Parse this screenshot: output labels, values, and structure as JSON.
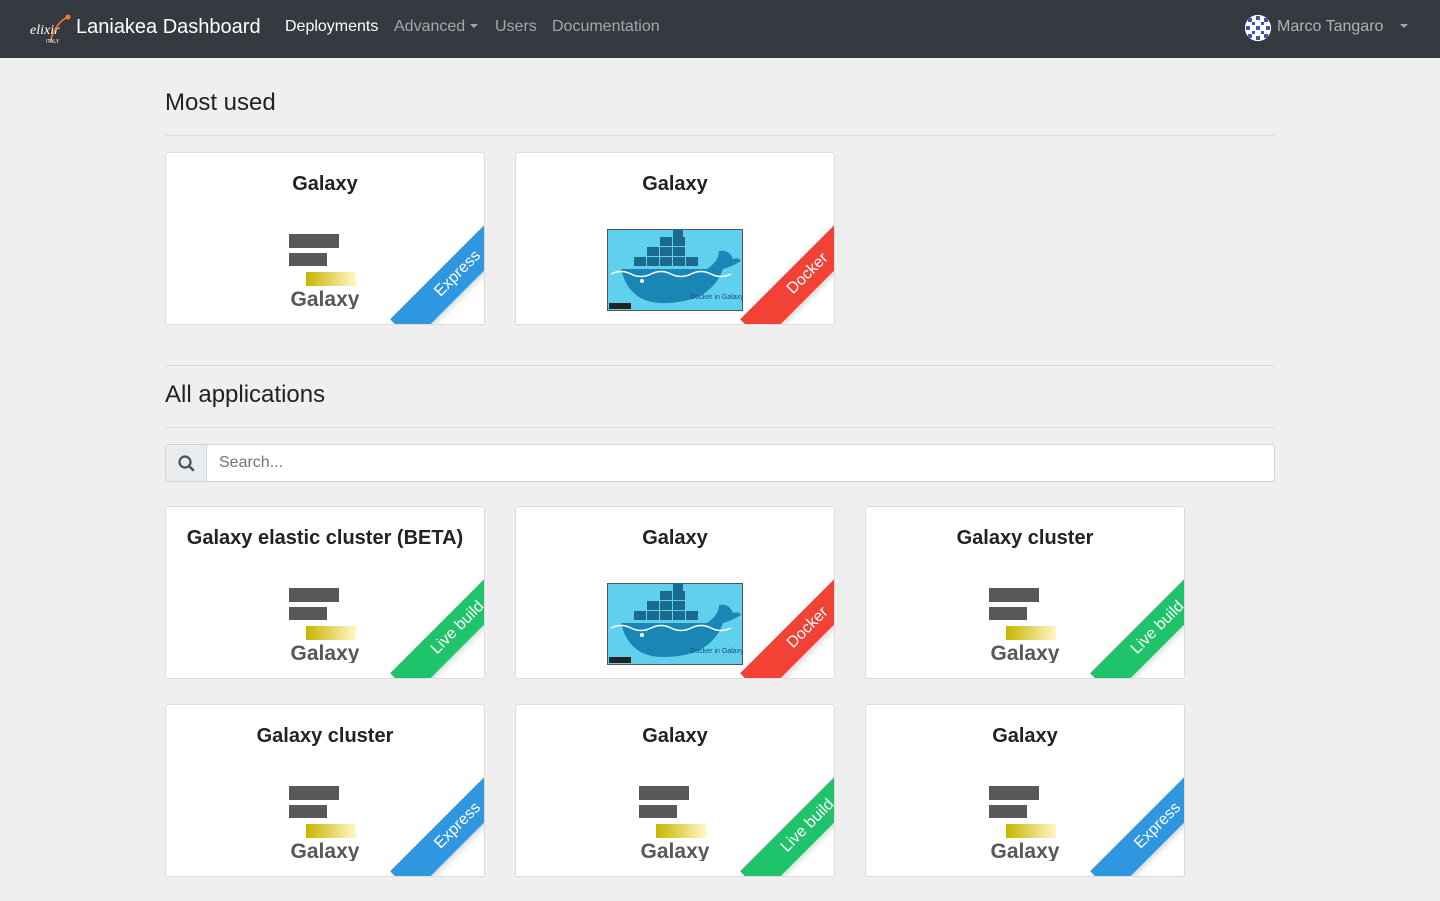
{
  "navbar": {
    "brand_title": "Laniakea Dashboard",
    "logo_text": "elixir",
    "logo_subtext": "ITALY",
    "links": [
      "Deployments",
      "Advanced",
      "Users",
      "Documentation"
    ],
    "user_name": "Marco Tangaro",
    "bg_color": "#343a40"
  },
  "most_used": {
    "title": "Most used",
    "cards": [
      {
        "title": "Galaxy",
        "badge": "Express",
        "logo": "galaxy-logo"
      },
      {
        "title": "Galaxy",
        "badge": "Docker",
        "logo": "docker-galaxy-logo"
      }
    ]
  },
  "all_apps": {
    "title": "All applications",
    "search_placeholder": "Search...",
    "cards": [
      {
        "title": "Galaxy elastic cluster (BETA)",
        "badge": "Live build",
        "logo": "galaxy-logo"
      },
      {
        "title": "Galaxy",
        "badge": "Docker",
        "logo": "docker-galaxy-logo"
      },
      {
        "title": "Galaxy cluster",
        "badge": "Live build",
        "logo": "galaxy-logo"
      },
      {
        "title": "Galaxy cluster",
        "badge": "Express",
        "logo": "galaxy-logo"
      },
      {
        "title": "Galaxy",
        "badge": "Live build",
        "logo": "galaxy-logo"
      },
      {
        "title": "Galaxy",
        "badge": "Express",
        "logo": "galaxy-logo"
      }
    ]
  },
  "galaxy_logo_text": "Galaxy",
  "docker_logo_text": "Docker in Galaxy",
  "badge_colors": {
    "Express": "#2f96e0",
    "Docker": "#f14235",
    "Live build": "#1fc36a"
  }
}
